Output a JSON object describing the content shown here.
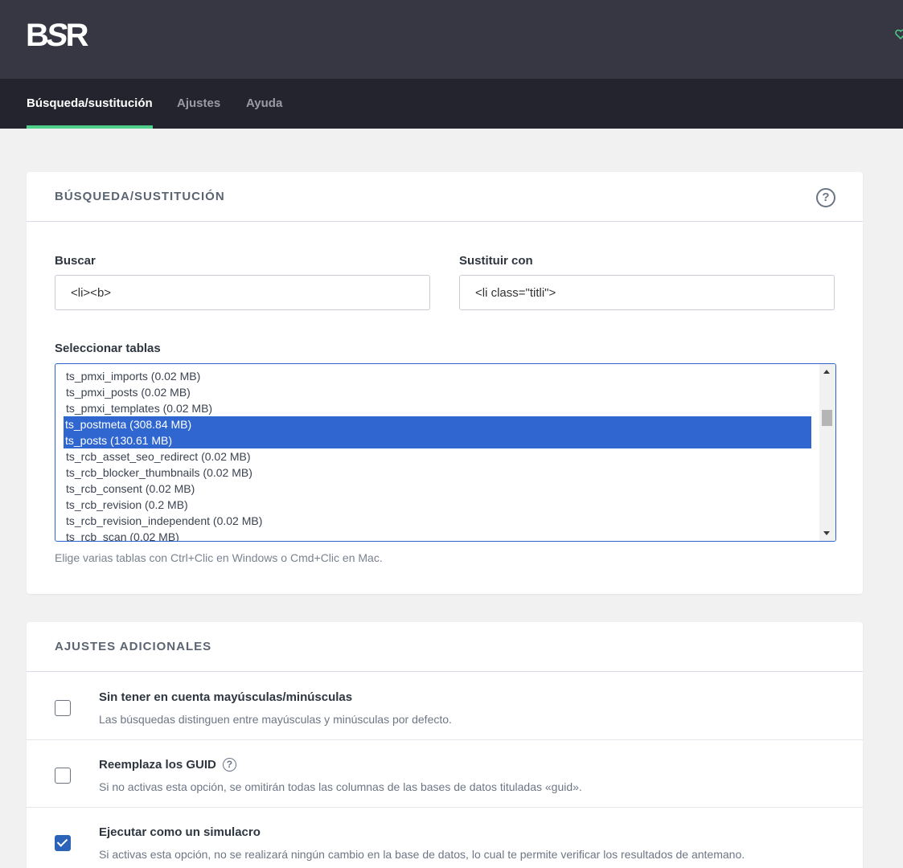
{
  "header": {
    "logo_b": "B",
    "logo_s": "S",
    "logo_r": "R"
  },
  "nav": {
    "tabs": [
      {
        "label": "Búsqueda/sustitución",
        "active": true
      },
      {
        "label": "Ajustes",
        "active": false
      },
      {
        "label": "Ayuda",
        "active": false
      }
    ]
  },
  "search_card": {
    "title": "BÚSQUEDA/SUSTITUCIÓN",
    "help_glyph": "?",
    "search_label": "Buscar",
    "search_value": "<li><b>",
    "replace_label": "Sustituir con",
    "replace_value": "<li class=\"titli\">",
    "tables_label": "Seleccionar tablas",
    "tables": [
      {
        "label": "ts_pmxi_imports (0.02 MB)",
        "selected": false
      },
      {
        "label": "ts_pmxi_posts (0.02 MB)",
        "selected": false
      },
      {
        "label": "ts_pmxi_templates (0.02 MB)",
        "selected": false
      },
      {
        "label": "ts_postmeta (308.84 MB)",
        "selected": true
      },
      {
        "label": "ts_posts (130.61 MB)",
        "selected": true
      },
      {
        "label": "ts_rcb_asset_seo_redirect (0.02 MB)",
        "selected": false
      },
      {
        "label": "ts_rcb_blocker_thumbnails (0.02 MB)",
        "selected": false
      },
      {
        "label": "ts_rcb_consent (0.02 MB)",
        "selected": false
      },
      {
        "label": "ts_rcb_revision (0.2 MB)",
        "selected": false
      },
      {
        "label": "ts_rcb_revision_independent (0.02 MB)",
        "selected": false
      },
      {
        "label": "ts_rcb_scan (0.02 MB)",
        "selected": false
      }
    ],
    "hint": "Elige varias tablas con Ctrl+Clic en Windows o Cmd+Clic en Mac."
  },
  "settings_card": {
    "title": "AJUSTES ADICIONALES",
    "options": [
      {
        "title": "Sin tener en cuenta mayúsculas/minúsculas",
        "desc": "Las búsquedas distinguen entre mayúsculas y minúsculas por defecto.",
        "checked": false
      },
      {
        "title": "Reemplaza los GUID",
        "desc": "Si no activas esta opción, se omitirán todas las columnas de las bases de datos tituladas «guid».",
        "checked": false
      },
      {
        "title": "Ejecutar como un simulacro",
        "desc": "Si activas esta opción, no se realizará ningún cambio en la base de datos, lo cual te permite verificar los resultados de antemano.",
        "checked": true
      }
    ]
  },
  "colors": {
    "header_bg": "#363742",
    "nav_bg": "#23242d",
    "active_tab_accent": "#4ecf8a",
    "selection_blue": "#2f66d0",
    "checkbox_checked": "#2a63b8"
  },
  "icons": [
    "bsr-logo",
    "heart-icon",
    "help-icon",
    "checkbox-icon"
  ]
}
